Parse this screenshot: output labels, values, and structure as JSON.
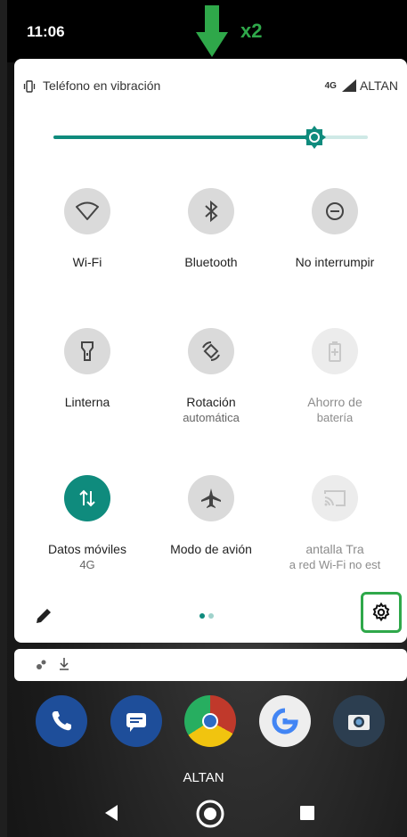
{
  "status": {
    "time": "11:06"
  },
  "annotation": {
    "label": "x2",
    "color": "#2fa84a"
  },
  "panel": {
    "vibration_text": "Teléfono en vibración",
    "network_type": "4G",
    "carrier": "ALTAN",
    "brightness": 0.83
  },
  "tiles": [
    {
      "icon": "wifi-icon",
      "label": "Wi-Fi",
      "sub": "",
      "state": "off"
    },
    {
      "icon": "bluetooth-icon",
      "label": "Bluetooth",
      "sub": "",
      "state": "off"
    },
    {
      "icon": "do-not-disturb-icon",
      "label": "No interrumpir",
      "sub": "",
      "state": "off"
    },
    {
      "icon": "flashlight-icon",
      "label": "Linterna",
      "sub": "",
      "state": "off"
    },
    {
      "icon": "auto-rotate-icon",
      "label": "Rotación",
      "sub": "automática",
      "state": "off"
    },
    {
      "icon": "battery-saver-icon",
      "label": "Ahorro de",
      "sub": "batería",
      "state": "disabled"
    },
    {
      "icon": "mobile-data-icon",
      "label": "Datos móviles",
      "sub": "4G",
      "state": "active"
    },
    {
      "icon": "airplane-icon",
      "label": "Modo de avión",
      "sub": "",
      "state": "off"
    },
    {
      "icon": "cast-icon",
      "label": "antalla     Tra",
      "sub": "a red Wi-Fi no est",
      "state": "disabled"
    }
  ],
  "home": {
    "carrier_label": "ALTAN"
  },
  "colors": {
    "accent": "#0f8b7d",
    "highlight": "#2fa84a"
  }
}
